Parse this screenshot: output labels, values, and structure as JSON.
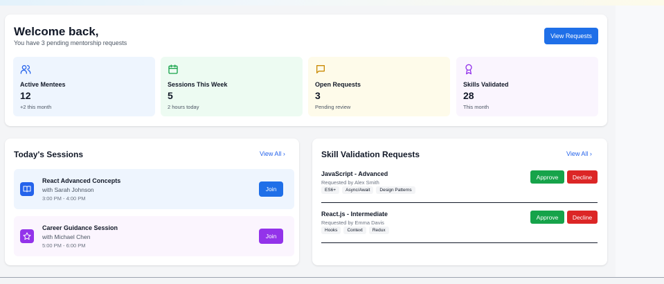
{
  "welcome": {
    "title": "Welcome back,",
    "subtitle": "You have 3 pending mentorship requests",
    "view_requests_label": "View Requests"
  },
  "stats": [
    {
      "icon": "users-icon",
      "label": "Active Mentees",
      "value": "12",
      "note": "+2 this month",
      "bg": "#eef5fe",
      "accent": "#2563eb"
    },
    {
      "icon": "calendar-icon",
      "label": "Sessions This Week",
      "value": "5",
      "note": "2 hours today",
      "bg": "#edfbf2",
      "accent": "#16a34a"
    },
    {
      "icon": "message-icon",
      "label": "Open Requests",
      "value": "3",
      "note": "Pending review",
      "bg": "#fefbea",
      "accent": "#ca8a04"
    },
    {
      "icon": "award-icon",
      "label": "Skills Validated",
      "value": "28",
      "note": "This month",
      "bg": "#faf5fe",
      "accent": "#9333ea"
    }
  ],
  "sessions": {
    "title": "Today's Sessions",
    "view_all": "View All ›",
    "items": [
      {
        "icon": "book-icon",
        "title": "React Advanced Concepts",
        "with": "with Sarah Johnson",
        "time": "3:00 PM - 4:00 PM",
        "join": "Join",
        "bg": "#eef5fe",
        "accent": "#2563eb"
      },
      {
        "icon": "star-icon",
        "title": "Career Guidance Session",
        "with": "with Michael Chen",
        "time": "5:00 PM - 6:00 PM",
        "join": "Join",
        "bg": "#fbf5fe",
        "accent": "#9333ea"
      }
    ]
  },
  "skills": {
    "title": "Skill Validation Requests",
    "view_all": "View All ›",
    "approve_label": "Approve",
    "decline_label": "Decline",
    "items": [
      {
        "title": "JavaScript - Advanced",
        "by": "Requested by Alex Smith",
        "tags": [
          "ES6+",
          "Async/Await",
          "Design Patterns"
        ]
      },
      {
        "title": "React.js - Intermediate",
        "by": "Requested by Emma Davis",
        "tags": [
          "Hooks",
          "Context",
          "Redux"
        ]
      }
    ]
  }
}
